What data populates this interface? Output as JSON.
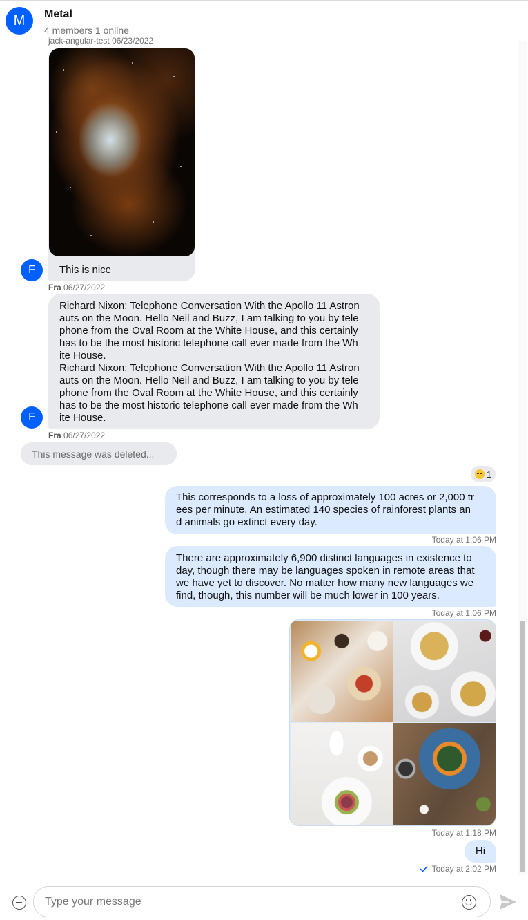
{
  "channel": {
    "avatar_letter": "M",
    "title": "Metal",
    "subtitle": "4 members 1 online"
  },
  "messages": {
    "top_meta": {
      "name": "jack-angular-test",
      "date": "06/23/2022"
    },
    "image_caption": "This is nice",
    "user_avatar_letter": "F",
    "meta1": {
      "name": "Fra",
      "date": "06/27/2022"
    },
    "long_text": {
      "p1": [
        "Richard Nixon: Telephone Conversation With the Apollo 11 Astron",
        "auts on the Moon. Hello Neil and Buzz, I am talking to you by tele",
        "phone from the Oval Room at the White House, and this certainly",
        "has to be the most historic telephone call ever made from the Wh",
        "ite House."
      ],
      "p2": [
        "Richard Nixon: Telephone Conversation With the Apollo 11 Astron",
        "auts on the Moon. Hello Neil and Buzz, I am talking to you by tele",
        "phone from the Oval Room at the White House, and this certainly",
        "has to be the most historic telephone call ever made from the Wh",
        "ite House."
      ]
    },
    "meta2": {
      "name": "Fra",
      "date": "06/27/2022"
    },
    "deleted_text": "This message was deleted...",
    "reaction_count": "1",
    "out1": [
      "This corresponds to a loss of approximately 100 acres or 2,000 tr",
      "ees per minute. An estimated 140 species of rainforest plants an",
      "d animals go extinct every day."
    ],
    "out1_time": "Today at 1:06 PM",
    "out2": [
      "There are approximately 6,900 distinct languages in existence to",
      "day, though there may be languages spoken in remote areas that",
      "we have yet to discover. No matter how many new languages we",
      "find, though, this number will be much lower in 100 years."
    ],
    "out2_time": "Today at 1:06 PM",
    "gallery_time": "Today at 1:18 PM",
    "out3": "Hi",
    "out3_time": "Today at 2:02 PM"
  },
  "composer": {
    "placeholder": "Type your message"
  },
  "icons": {
    "add": "plus-circle-icon",
    "emoji": "emoji-icon",
    "send": "send-icon",
    "read": "checkmark-icon"
  },
  "colors": {
    "accent": "#005fff",
    "incoming_bubble": "#e9eaed",
    "outgoing_bubble": "#dbeafe"
  }
}
